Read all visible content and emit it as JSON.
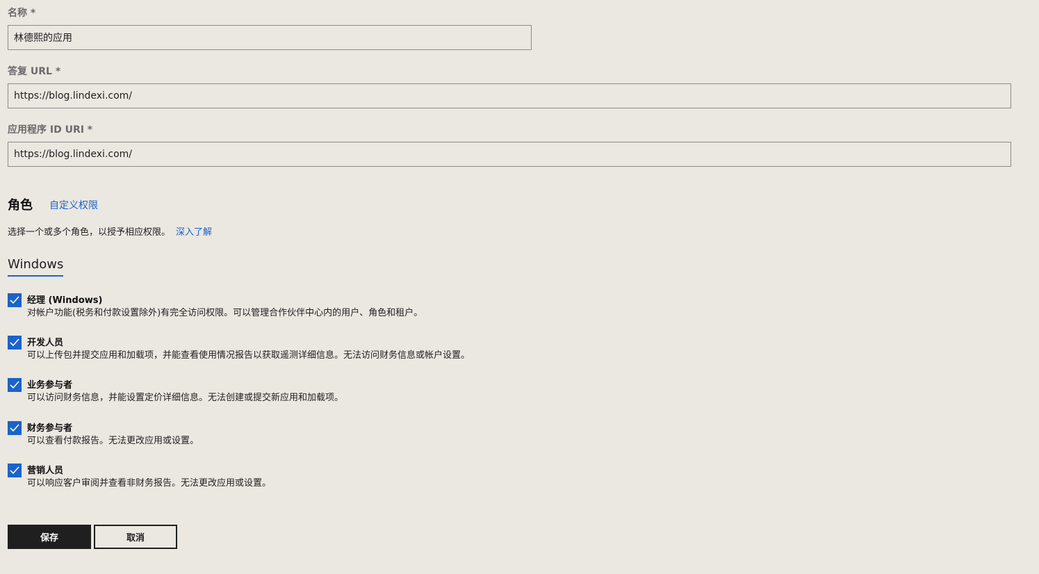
{
  "form": {
    "name": {
      "label": "名称 *",
      "value": "林德熙的应用"
    },
    "reply_url": {
      "label": "答复 URL *",
      "value": "https://blog.lindexi.com/"
    },
    "app_id_uri": {
      "label": "应用程序 ID URI *",
      "value": "https://blog.lindexi.com/"
    }
  },
  "roles": {
    "title": "角色",
    "custom_link": "自定义权限",
    "description": "选择一个或多个角色，以授予相应权限。",
    "learn_more": "深入了解",
    "tab": "Windows",
    "items": [
      {
        "name": "经理 (Windows)",
        "description": "对帐户功能(税务和付款设置除外)有完全访问权限。可以管理合作伙伴中心内的用户、角色和租户。",
        "checked": true
      },
      {
        "name": "开发人员",
        "description": "可以上传包并提交应用和加载项，并能查看使用情况报告以获取遥测详细信息。无法访问财务信息或帐户设置。",
        "checked": true
      },
      {
        "name": "业务参与者",
        "description": "可以访问财务信息，并能设置定价详细信息。无法创建或提交新应用和加载项。",
        "checked": true
      },
      {
        "name": "财务参与者",
        "description": "可以查看付款报告。无法更改应用或设置。",
        "checked": true
      },
      {
        "name": "营销人员",
        "description": "可以响应客户审阅并查看非财务报告。无法更改应用或设置。",
        "checked": true
      }
    ]
  },
  "actions": {
    "save": "保存",
    "cancel": "取消"
  },
  "colors": {
    "background": "#ebe7e1",
    "accent": "#1a63c8",
    "primary_button": "#1f1f1f"
  }
}
